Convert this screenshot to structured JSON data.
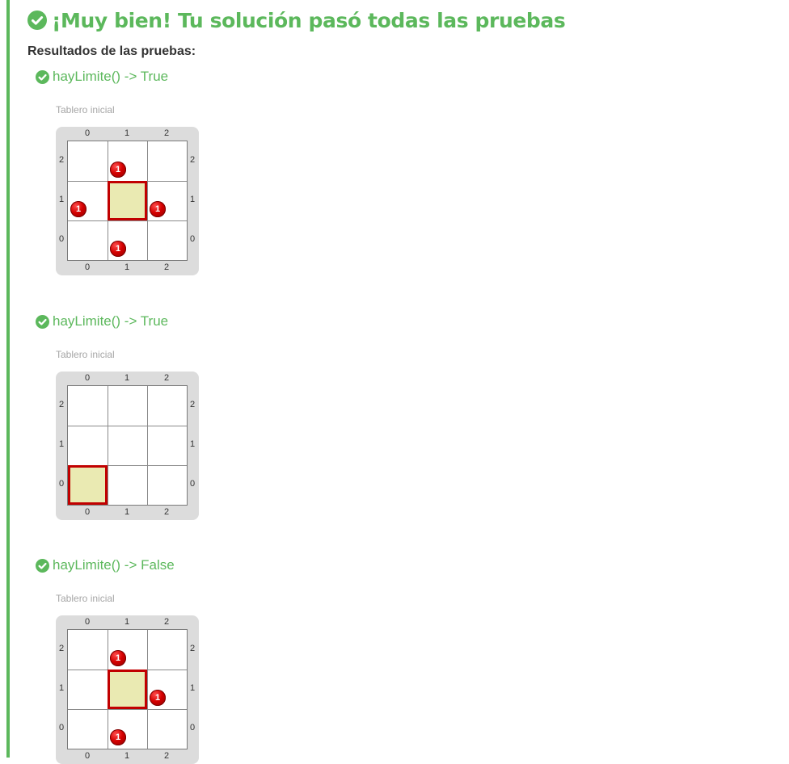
{
  "header": {
    "title": "¡Muy bien! Tu solución pasó todas las pruebas",
    "icon": "check-circle-icon",
    "color": "#5cb85c"
  },
  "results_title": "Resultados de las pruebas:",
  "board_labels": {
    "cols": [
      "0",
      "1",
      "2"
    ],
    "rows": [
      "2",
      "1",
      "0"
    ]
  },
  "tests": [
    {
      "title": "hayLimite() -> True",
      "caption": "Tablero inicial",
      "head": {
        "col": 1,
        "row": 1
      },
      "balls": [
        {
          "col": 1,
          "row": 2,
          "count": "1"
        },
        {
          "col": 0,
          "row": 1,
          "count": "1"
        },
        {
          "col": 2,
          "row": 1,
          "count": "1"
        },
        {
          "col": 1,
          "row": 0,
          "count": "1"
        }
      ]
    },
    {
      "title": "hayLimite() -> True",
      "caption": "Tablero inicial",
      "head": {
        "col": 0,
        "row": 0
      },
      "balls": []
    },
    {
      "title": "hayLimite() -> False",
      "caption": "Tablero inicial",
      "head": {
        "col": 1,
        "row": 1
      },
      "balls": [
        {
          "col": 1,
          "row": 2,
          "count": "1"
        },
        {
          "col": 2,
          "row": 1,
          "count": "1"
        },
        {
          "col": 1,
          "row": 0,
          "count": "1"
        }
      ]
    }
  ],
  "colors": {
    "accent": "#5cb85c",
    "head_fill": "#eaeab2",
    "head_border": "#c10000",
    "ball": "#d40000"
  }
}
